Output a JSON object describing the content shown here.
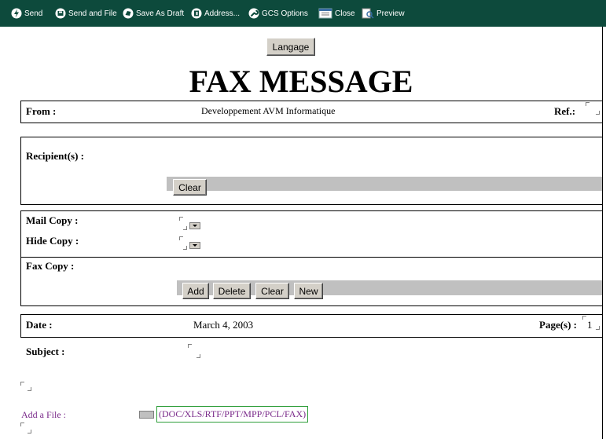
{
  "toolbar": {
    "items": [
      {
        "label": "Send",
        "icon": "lightning-icon"
      },
      {
        "label": "Send and File",
        "icon": "disk-icon"
      },
      {
        "label": "Save As Draft",
        "icon": "draft-icon"
      },
      {
        "label": "Address...",
        "icon": "address-book-icon"
      },
      {
        "label": "GCS Options",
        "icon": "wrench-icon"
      },
      {
        "label": "Close",
        "icon": "close-window-icon"
      },
      {
        "label": "Preview",
        "icon": "preview-icon"
      }
    ]
  },
  "language_button": "Langage",
  "title": "FAX MESSAGE",
  "from": {
    "label": "From :",
    "value": "Developpement AVM Informatique",
    "ref_label": "Ref.:"
  },
  "recipients": {
    "label": "Recipient(s) :",
    "clear": "Clear"
  },
  "copies": {
    "mail_label": "Mail Copy :",
    "hide_label": "Hide Copy :",
    "fax_label": "Fax Copy :",
    "buttons": {
      "add": "Add",
      "delete": "Delete",
      "clear": "Clear",
      "new": "New"
    }
  },
  "date": {
    "label": "Date :",
    "value": "March 4, 2003",
    "pages_label": "Page(s) :",
    "pages_value": "1"
  },
  "subject": {
    "label": "Subject :"
  },
  "attachment": {
    "label": "Add a File :",
    "types": "(DOC/XLS/RTF/PPT/MPP/PCL/FAX)"
  },
  "colors": {
    "toolbar_bg": "#0d4a3c",
    "link_purple": "#7a2a8a",
    "button_face": "#d4d0c8"
  }
}
